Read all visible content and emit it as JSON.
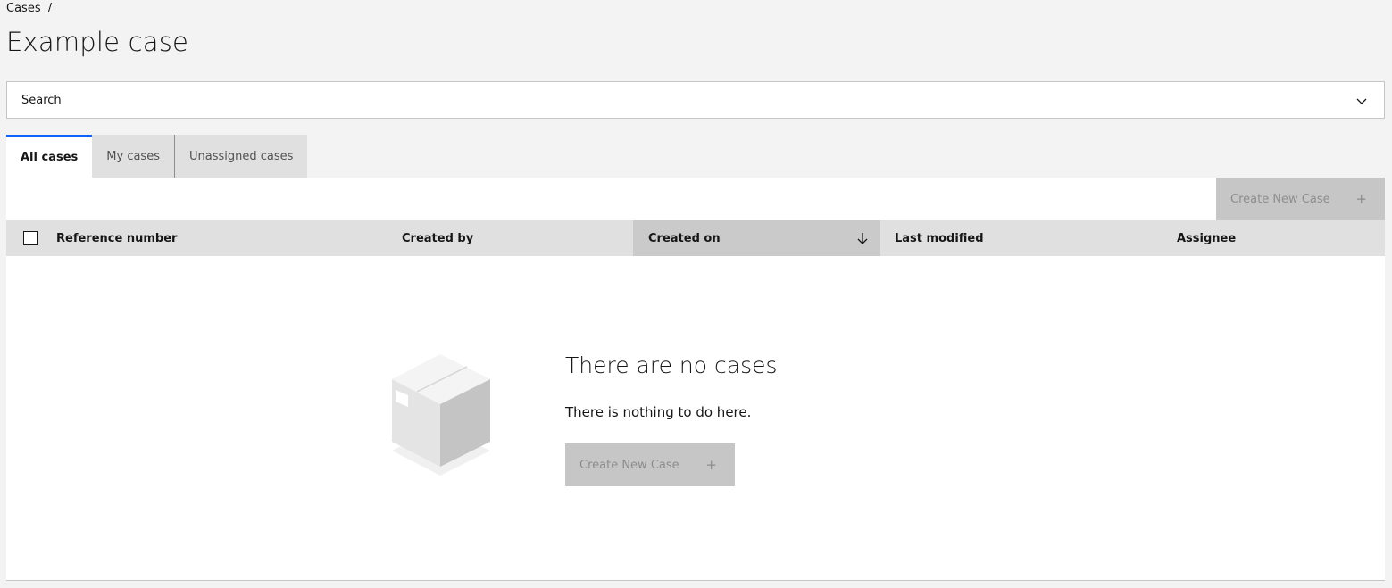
{
  "breadcrumb": {
    "item": "Cases",
    "separator": "/"
  },
  "page": {
    "title": "Example case"
  },
  "search": {
    "placeholder": "Search",
    "icon": "chevron-down-icon"
  },
  "tabs": [
    {
      "label": "All cases",
      "active": true
    },
    {
      "label": "My cases",
      "active": false
    },
    {
      "label": "Unassigned cases",
      "active": false
    }
  ],
  "toolbar": {
    "create_label": "Create New Case",
    "create_icon": "+",
    "disabled": true
  },
  "table": {
    "columns": [
      {
        "label": "Reference number"
      },
      {
        "label": "Created by"
      },
      {
        "label": "Created on",
        "sorted": "descending"
      },
      {
        "label": "Last modified"
      },
      {
        "label": "Assignee"
      }
    ],
    "rows": []
  },
  "empty_state": {
    "title": "There are no cases",
    "message": "There is nothing to do here.",
    "button_label": "Create New Case",
    "button_icon": "+"
  },
  "colors": {
    "background": "#f3f3f3",
    "surface": "#ffffff",
    "header": "#e0e0e0",
    "sorted_header": "#cacaca",
    "disabled_button": "#c6c6c6",
    "disabled_text": "#8d8d8d",
    "accent": "#0f62fe"
  }
}
